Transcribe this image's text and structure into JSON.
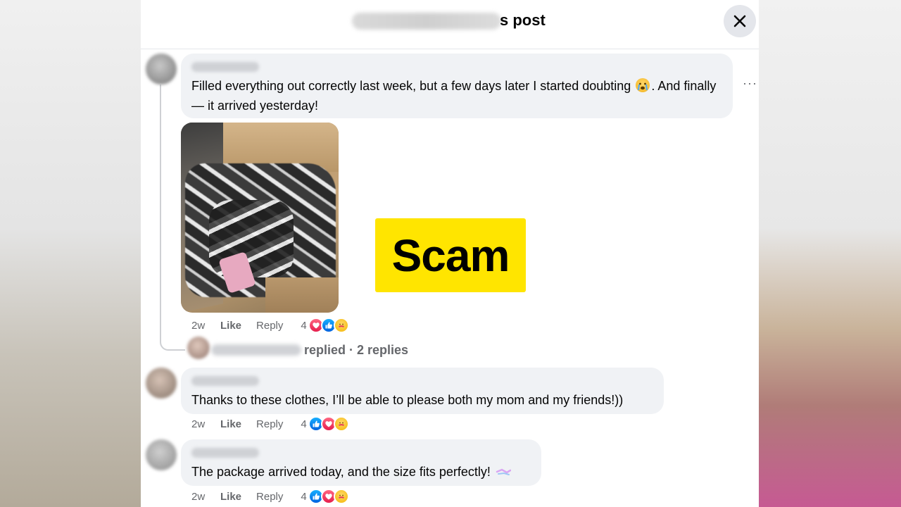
{
  "dialog": {
    "title_suffix": "s post",
    "close_label": "✕"
  },
  "comments": [
    {
      "text_before_emoji": "Filled everything out correctly last week, but a few days later I started doubting ",
      "text_after_emoji": ". And finally — it arrived yesterday!",
      "emoji": "loudly-crying-face",
      "meta": {
        "time": "2w",
        "like": "Like",
        "reply": "Reply",
        "reaction_count": "4"
      },
      "reactions": [
        "heart",
        "thumb",
        "care"
      ]
    },
    {
      "text": "Thanks to these clothes, I’ll be able to please both my mom and my friends!))",
      "meta": {
        "time": "2w",
        "like": "Like",
        "reply": "Reply",
        "reaction_count": "4"
      },
      "reactions": [
        "thumb",
        "heart",
        "care"
      ]
    },
    {
      "text_before_emoji": "The package arrived today, and the size fits perfectly! ",
      "emoji": "sparkles",
      "meta": {
        "time": "2w",
        "like": "Like",
        "reply": "Reply",
        "reaction_count": "4"
      },
      "reactions": [
        "thumb",
        "heart",
        "care"
      ]
    }
  ],
  "replies_summary": "replied · 2 replies",
  "overlay_label": "Scam",
  "more_options": "···",
  "colors": {
    "bubble": "#f0f2f5",
    "secondary_text": "#65676b",
    "overlay_bg": "#ffe500"
  }
}
